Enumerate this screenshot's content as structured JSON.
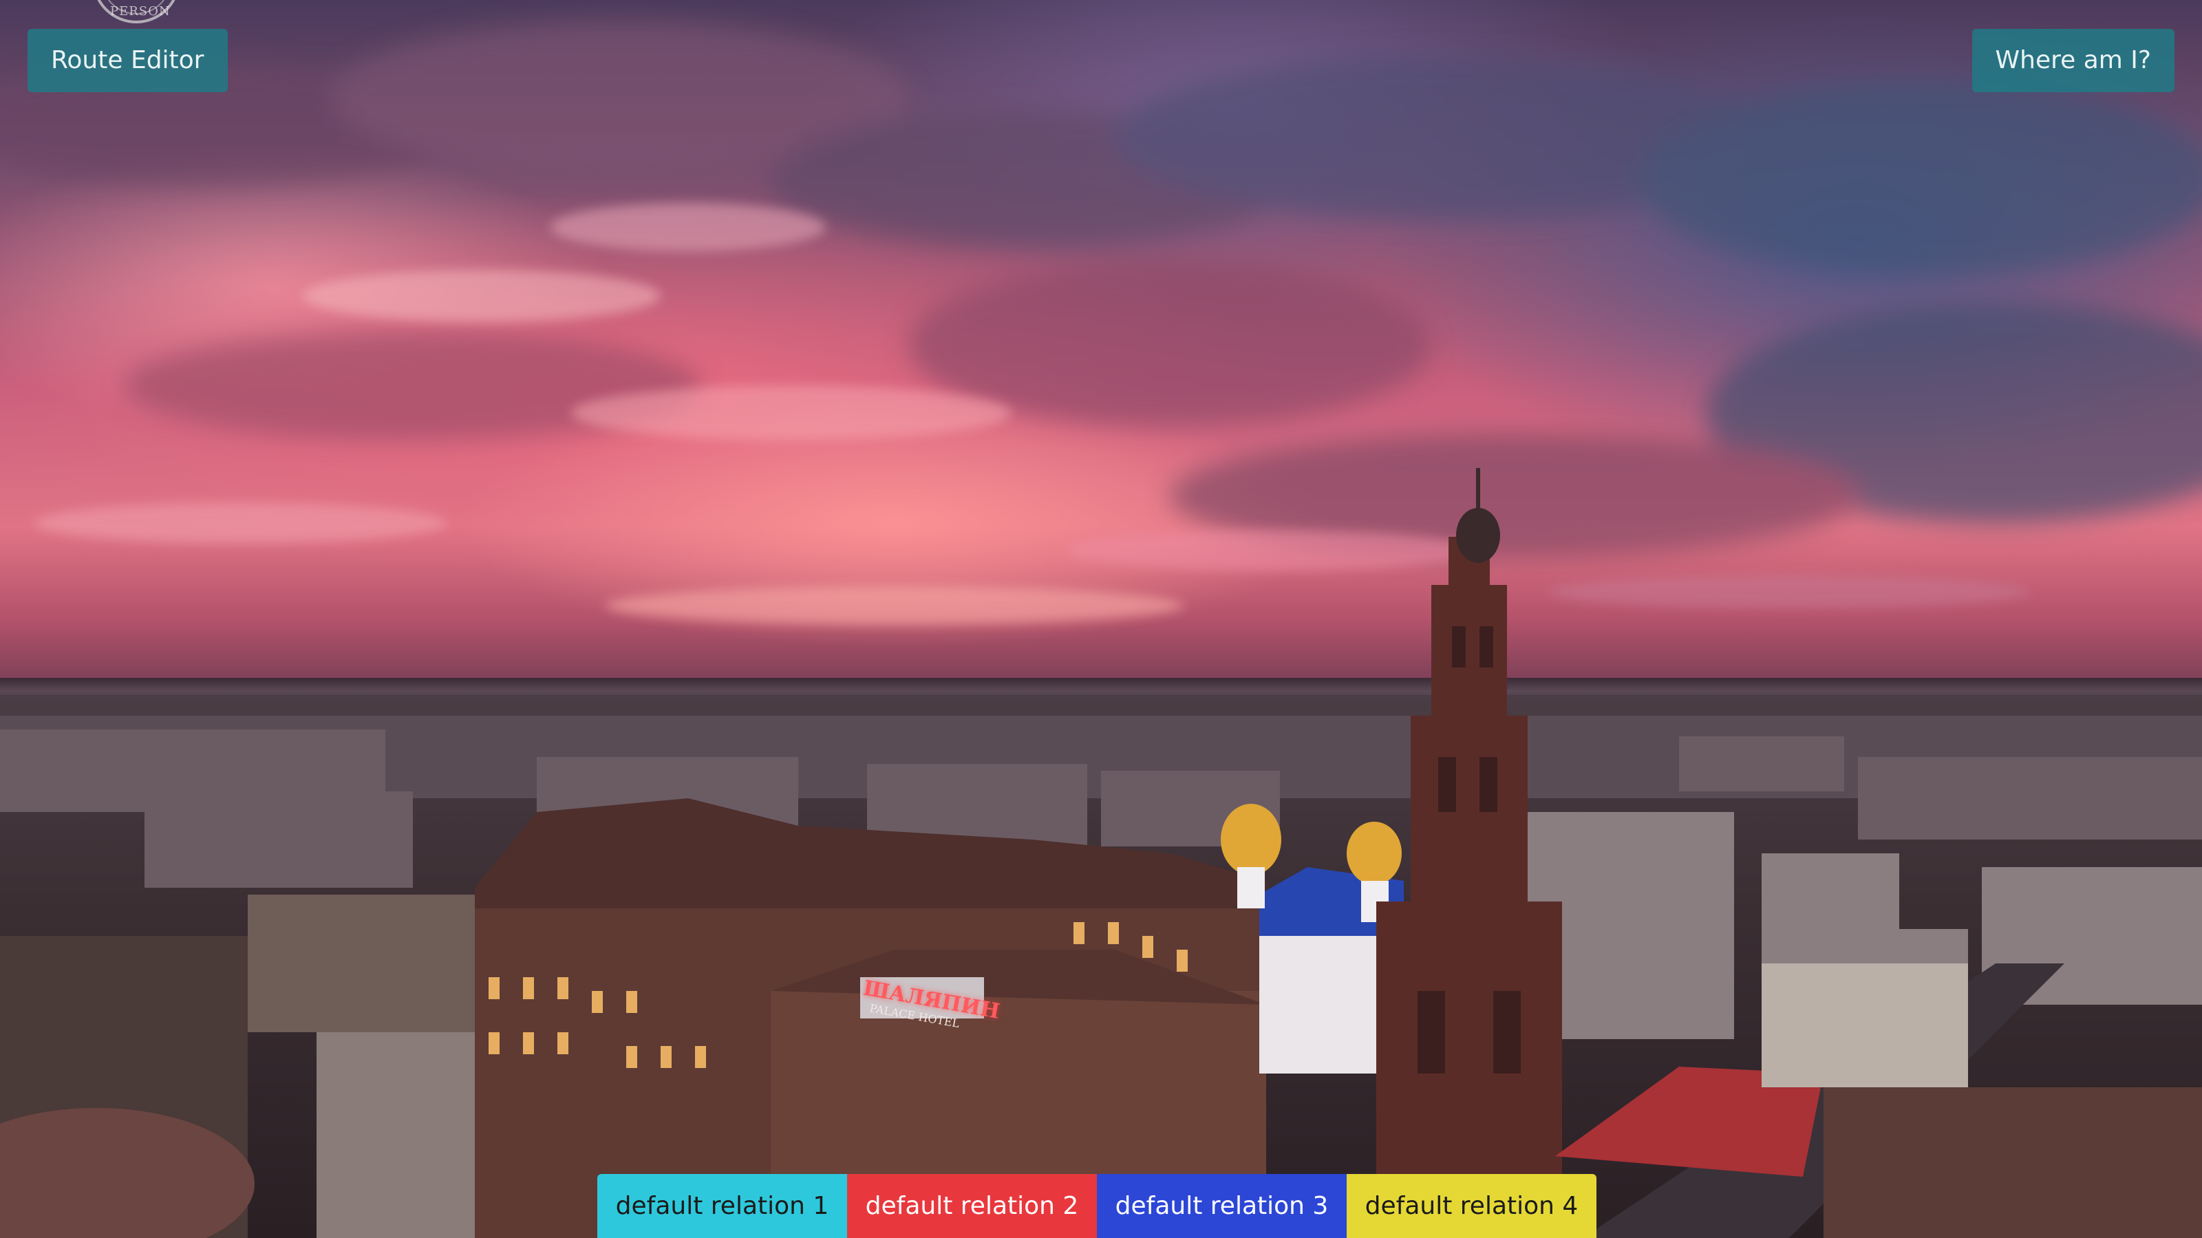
{
  "logo": {
    "text": "PERSON",
    "icon": "circular-seal-logo"
  },
  "header": {
    "route_editor_label": "Route Editor",
    "where_am_i_label": "Where am I?",
    "button_color": "#1f7d87"
  },
  "background": {
    "description_icon": "city-sunset-photo",
    "sign_text": "ШАЛЯПИН",
    "sign_subtext": "PALACE HOTEL"
  },
  "relations": [
    {
      "label": "default relation 1",
      "color": "#2ec8dc",
      "text_color": "#1a1a1a"
    },
    {
      "label": "default relation 2",
      "color": "#e8383d",
      "text_color": "#ffffff"
    },
    {
      "label": "default relation 3",
      "color": "#2c47d6",
      "text_color": "#ffffff"
    },
    {
      "label": "default relation 4",
      "color": "#e5d834",
      "text_color": "#1a1a1a"
    }
  ]
}
